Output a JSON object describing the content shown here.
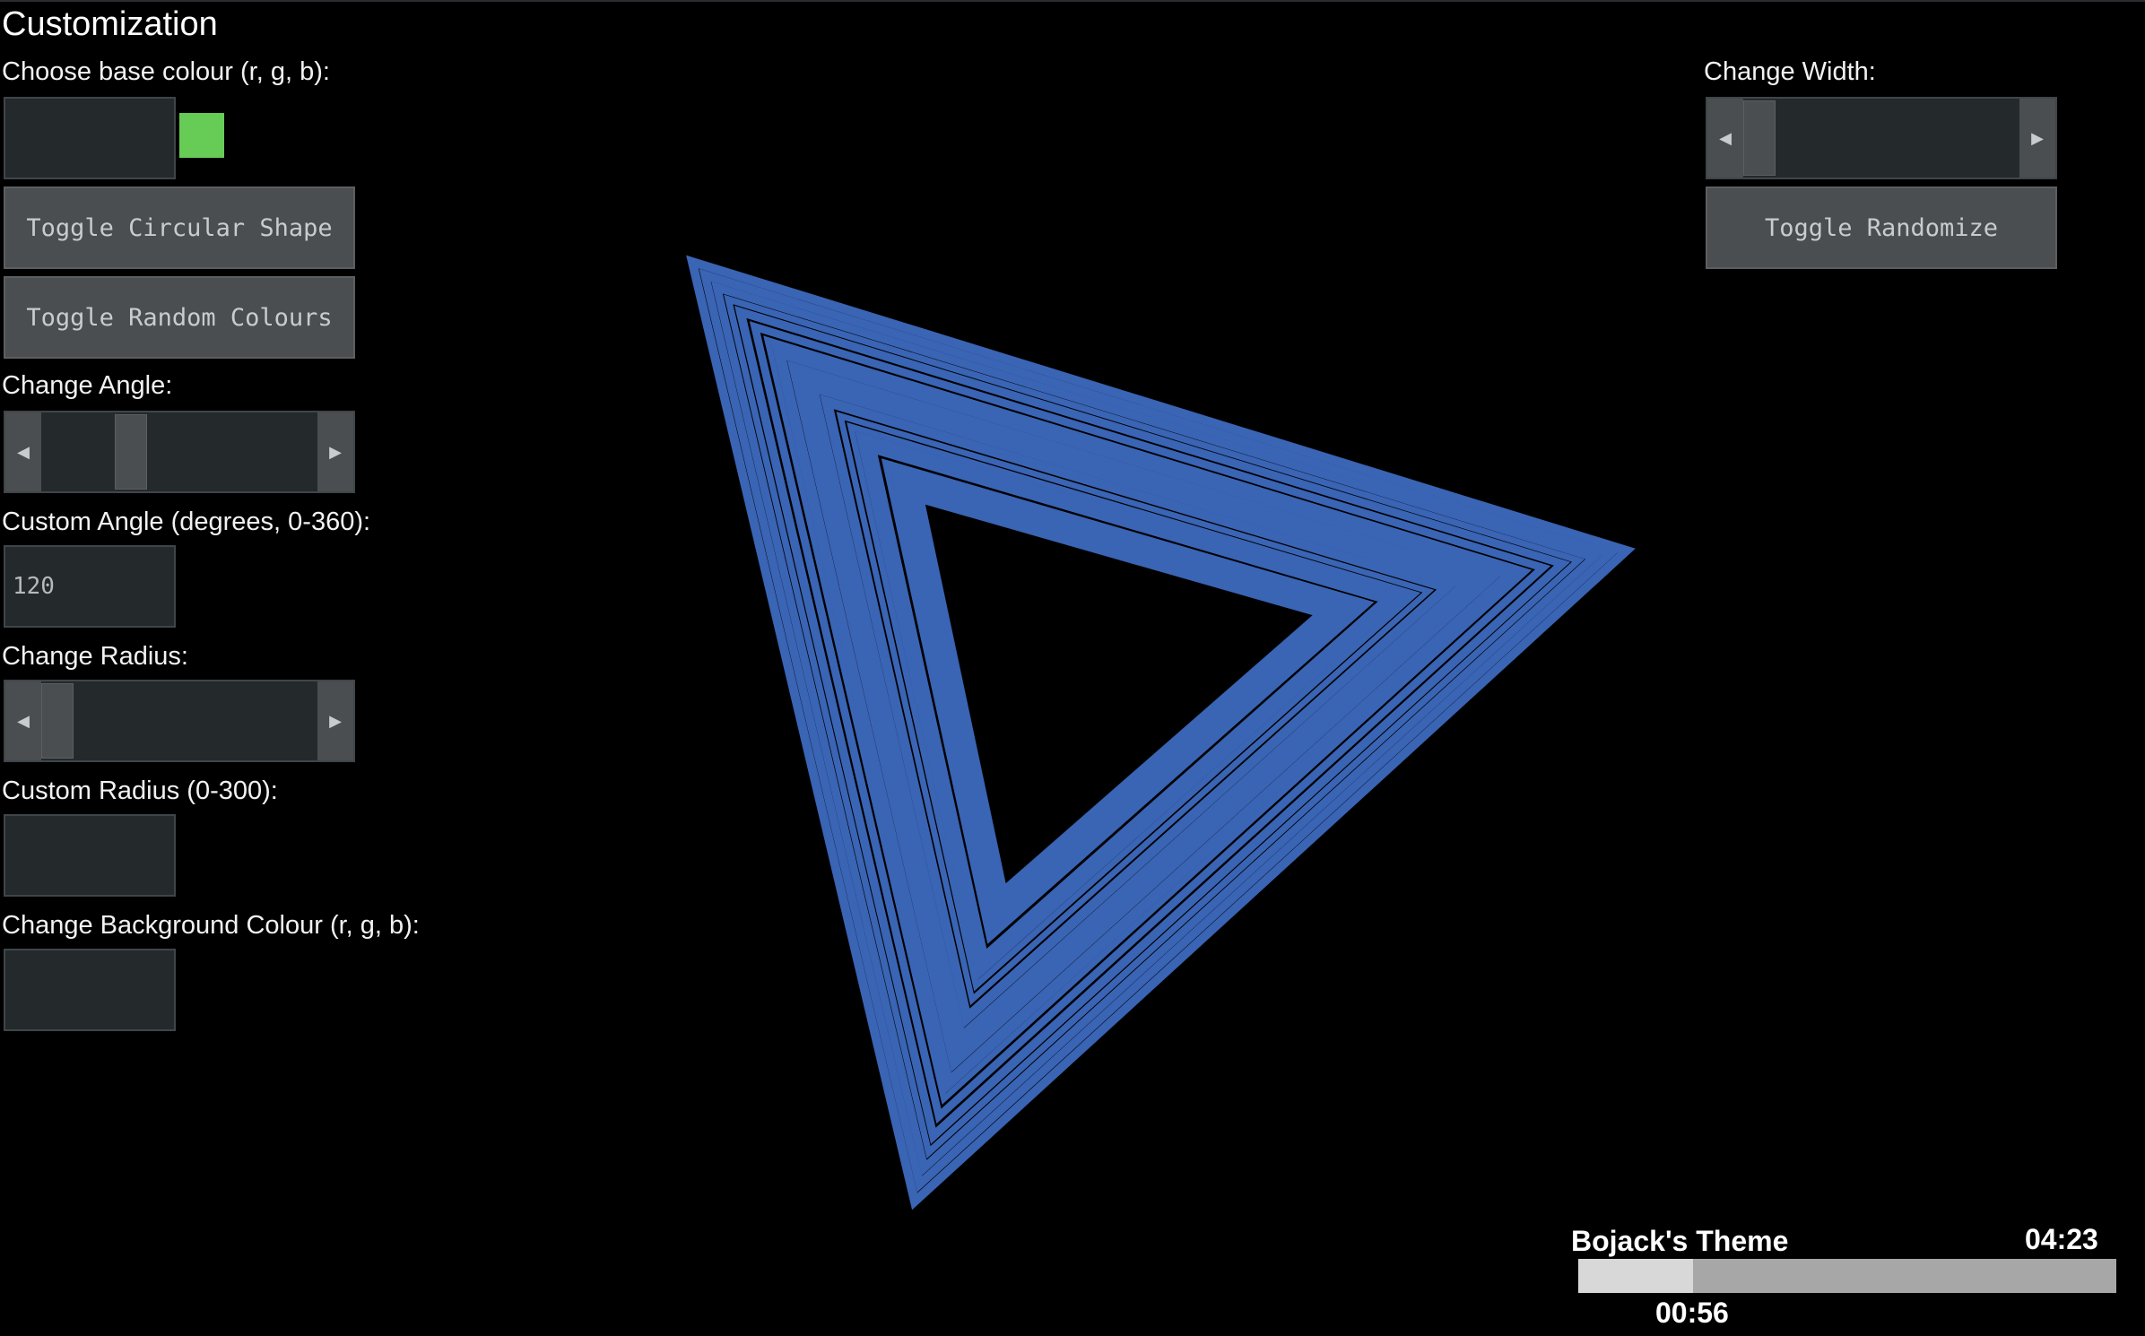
{
  "panel": {
    "title": "Customization",
    "base_colour_label": "Choose base colour (r, g, b):",
    "base_colour_value": "",
    "base_colour_swatch": "#66cc55",
    "toggle_circular_label": "Toggle Circular Shape",
    "toggle_random_colours_label": "Toggle Random Colours",
    "change_angle_label": "Change Angle:",
    "angle_slider_value": 0.3,
    "custom_angle_label": "Custom Angle (degrees, 0-360):",
    "custom_angle_value": "120",
    "change_radius_label": "Change Radius:",
    "radius_slider_value": 0.0,
    "custom_radius_label": "Custom Radius (0-300):",
    "custom_radius_value": "",
    "bg_colour_label": "Change Background Colour (r, g, b):",
    "bg_colour_value": ""
  },
  "right_panel": {
    "change_width_label": "Change Width:",
    "width_slider_value": 0.0,
    "toggle_randomize_label": "Toggle Randomize"
  },
  "visual": {
    "shape": "triangle",
    "stroke_color": "#3a64b4",
    "angle_degrees": 120
  },
  "player": {
    "track_title": "Bojack's Theme",
    "total_time": "04:23",
    "elapsed_time": "00:56",
    "progress": 0.213
  },
  "icons": {
    "slider_left": "arrow-left-icon",
    "slider_right": "arrow-right-icon"
  }
}
